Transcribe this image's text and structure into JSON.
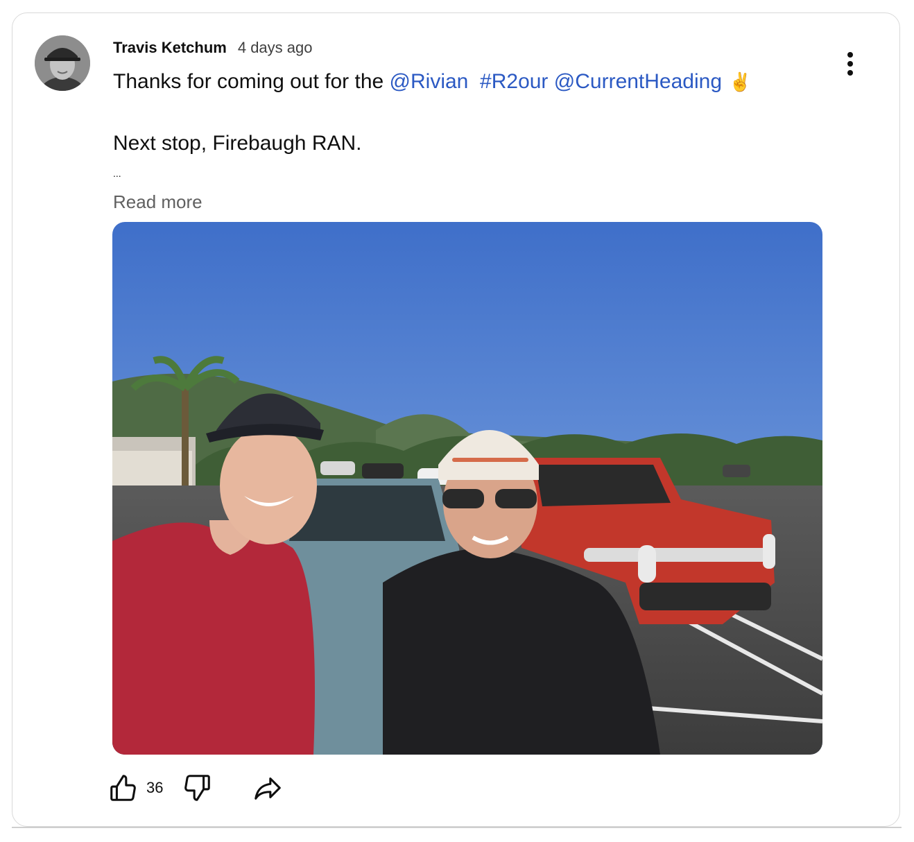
{
  "post": {
    "author": "Travis Ketchum",
    "time": "4 days ago",
    "text_prefix": "Thanks for coming out for the ",
    "mention1": "@Rivian",
    "hashtag": "#R2our",
    "mention2": "@CurrentHeading",
    "emoji": "✌️",
    "line2": "Next stop, Firebaugh RAN.",
    "ellipsis": "...",
    "read_more": "Read more"
  },
  "actions": {
    "like_count": "36"
  },
  "icons": [
    "more-vert-icon",
    "thumbs-up-icon",
    "thumbs-down-icon",
    "share-icon"
  ],
  "colors": {
    "link": "#2b59c3",
    "muted": "#606060",
    "border": "#d9d9d9"
  }
}
